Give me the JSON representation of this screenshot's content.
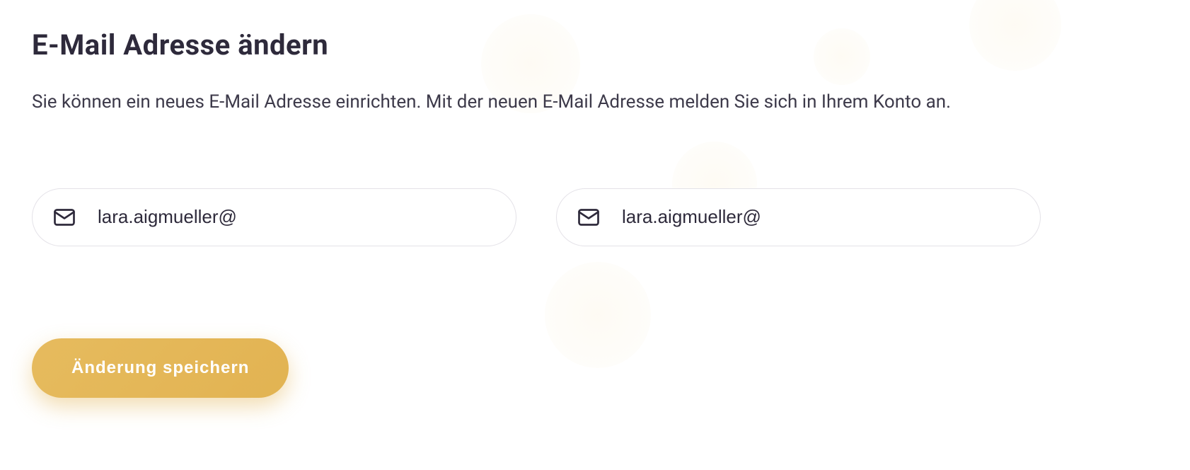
{
  "header": {
    "title": "E-Mail Adresse ändern",
    "description": "Sie können ein neues E-Mail Adresse einrichten. Mit der neuen E-Mail Adresse melden Sie sich in Ihrem Konto an."
  },
  "form": {
    "email1": {
      "value": "lara.aigmueller@"
    },
    "email2": {
      "value": "lara.aigmueller@"
    },
    "submit_label": "Änderung speichern"
  },
  "colors": {
    "accent": "#e2b352",
    "text_primary": "#2e2a3b",
    "border": "#e4e2e8"
  }
}
